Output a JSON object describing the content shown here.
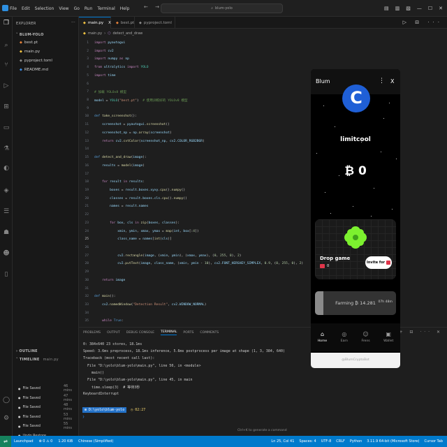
{
  "titlebar": {
    "menu": [
      "File",
      "Edit",
      "Selection",
      "View",
      "Go",
      "Run",
      "Terminal",
      "Help"
    ],
    "search": "blum-yolo"
  },
  "sidebar": {
    "title": "EXPLORER",
    "project": "BLUM-YOLO",
    "files": [
      {
        "name": "best.pt",
        "icon": "pytorch-file-icon",
        "color": "#e8833a"
      },
      {
        "name": "main.py",
        "icon": "python-file-icon",
        "color": "#f5c542"
      },
      {
        "name": "pyproject.toml",
        "icon": "toml-file-icon",
        "color": "#8b8b8b"
      },
      {
        "name": "README.md",
        "icon": "info-file-icon",
        "color": "#3b8eea"
      }
    ],
    "outline": "OUTLINE",
    "timeline": "TIMELINE",
    "timeline_file": "main.py",
    "timeline_items": [
      {
        "label": "File Saved",
        "time": "46 mins"
      },
      {
        "label": "File Saved",
        "time": "47 mins"
      },
      {
        "label": "File Saved",
        "time": "48 mins"
      },
      {
        "label": "File Saved",
        "time": "53 mins"
      },
      {
        "label": "File Saved",
        "time": "55 mins"
      },
      {
        "label": "Undo Restore",
        "time": ""
      }
    ]
  },
  "tabs": [
    {
      "label": "main.py",
      "active": true,
      "close": "X"
    },
    {
      "label": "best.pt",
      "active": false,
      "close": ""
    },
    {
      "label": "pyproject.toml",
      "active": false,
      "close": ""
    }
  ],
  "breadcrumb": {
    "file": "main.py",
    "symbol": "detect_and_draw"
  },
  "code": [
    {
      "n": "1",
      "t": "import pyautogui"
    },
    {
      "n": "2",
      "t": "import cv2"
    },
    {
      "n": "3",
      "t": "import numpy as np"
    },
    {
      "n": "4",
      "t": "from ultralytics import YOLO"
    },
    {
      "n": "5",
      "t": "import time"
    },
    {
      "n": "6",
      "t": ""
    },
    {
      "n": "7",
      "t": "# 加载 YOLOv8 模型"
    },
    {
      "n": "8",
      "t": "model = YOLO(\"best.pt\")  # 使用训练好的 YOLOv8 模型"
    },
    {
      "n": "9",
      "t": ""
    },
    {
      "n": "10",
      "t": "def take_screenshot():"
    },
    {
      "n": "11",
      "t": "    screenshot = pyautogui.screenshot()"
    },
    {
      "n": "12",
      "t": "    screenshot_np = np.array(screenshot)"
    },
    {
      "n": "13",
      "t": "    return cv2.cvtColor(screenshot_np, cv2.COLOR_RGB2BGR)"
    },
    {
      "n": "14",
      "t": ""
    },
    {
      "n": "15",
      "t": "def detect_and_draw(image):"
    },
    {
      "n": "16",
      "t": "    results = model(image)"
    },
    {
      "n": "17",
      "t": ""
    },
    {
      "n": "18",
      "t": "    for result in results:"
    },
    {
      "n": "19",
      "t": "        boxes = result.boxes.xyxy.cpu().numpy()"
    },
    {
      "n": "20",
      "t": "        classes = result.boxes.cls.cpu().numpy()"
    },
    {
      "n": "21",
      "t": "        names = result.names"
    },
    {
      "n": "22",
      "t": ""
    },
    {
      "n": "23",
      "t": "        for box, cls in zip(boxes, classes):"
    },
    {
      "n": "24",
      "t": "            xmin, ymin, xmax, ymax = map(int, box[:4])"
    },
    {
      "n": "25",
      "t": "            class_name = names[int(cls)]"
    },
    {
      "n": "26",
      "t": ""
    },
    {
      "n": "27",
      "t": "            cv2.rectangle(image, (xmin, ymin), (xmax, ymax), (0, 255, 0), 2)"
    },
    {
      "n": "28",
      "t": "            cv2.putText(image, class_name, (xmin, ymin - 10), cv2.FONT_HERSHEY_SIMPLEX, 0.9, (0, 255, 0), 2)"
    },
    {
      "n": "29",
      "t": ""
    },
    {
      "n": "30",
      "t": "    return image"
    },
    {
      "n": "31",
      "t": ""
    },
    {
      "n": "32",
      "t": "def main():"
    },
    {
      "n": "33",
      "t": "    cv2.namedWindow(\"Detection Result\", cv2.WINDOW_NORMAL)"
    },
    {
      "n": "34",
      "t": ""
    },
    {
      "n": "35",
      "t": "    while True:"
    }
  ],
  "panel": {
    "tabs": [
      "PROBLEMS",
      "OUTPUT",
      "DEBUG CONSOLE",
      "TERMINAL",
      "PORTS",
      "COMMENTS"
    ],
    "active": "TERMINAL",
    "lines": [
      "0: 384x640 23 stores, 18.1ms",
      "Speed: 3.6ms preprocess, 18.1ms inference, 5.6ms postprocess per image at shape (1, 3, 384, 640)",
      "Traceback (most recent call last):",
      "  File \"D:\\yolo\\blum-yolo\\main.py\", line 50, in <module>",
      "    main()",
      "  File \"D:\\yolo\\blum-yolo\\main.py\", line 45, in main",
      "    time.sleep(3)  # 等待3秒",
      "KeyboardInterrupt"
    ],
    "prompt_path": "D:\\yolo\\blum-yolo",
    "prompt_time": "02:27",
    "hint": "Ctrl+K to generate a command"
  },
  "statusbar": {
    "left": [
      "Launchpad",
      "⊗ 0 ⚠ 0",
      "1.20 KiB",
      "Chinese (Simplified)"
    ],
    "right": [
      "Ln 25, Col 41",
      "Spaces: 4",
      "UTF-8",
      "CRLF",
      "Python",
      "3.11.9 64-bit (Microsoft Store)",
      "Cursor Tab"
    ]
  },
  "blum": {
    "title": "Blum",
    "menu_icon": "⋮",
    "close_icon": "X",
    "avatar_letter": "C",
    "username": "limitcool",
    "balance": "₿ 0",
    "drop_title": "Drop game",
    "drop_count": "0",
    "invite_label": "Invite for",
    "farm_label": "Farming ₿ 14.281",
    "farm_time": "07h 48m",
    "farm_progress": 0.1,
    "nav": [
      {
        "label": "Home",
        "icon": "⌂",
        "active": true
      },
      {
        "label": "Earn",
        "icon": "◎",
        "active": false
      },
      {
        "label": "Frens",
        "icon": "☺",
        "active": false
      },
      {
        "label": "Wallet",
        "icon": "▣",
        "active": false
      }
    ],
    "footer": "@BlumCryptoBot",
    "accent": "#1f5fd6"
  },
  "colors": {
    "statusbar": "#007acc",
    "editor": "#1e1e1e"
  }
}
